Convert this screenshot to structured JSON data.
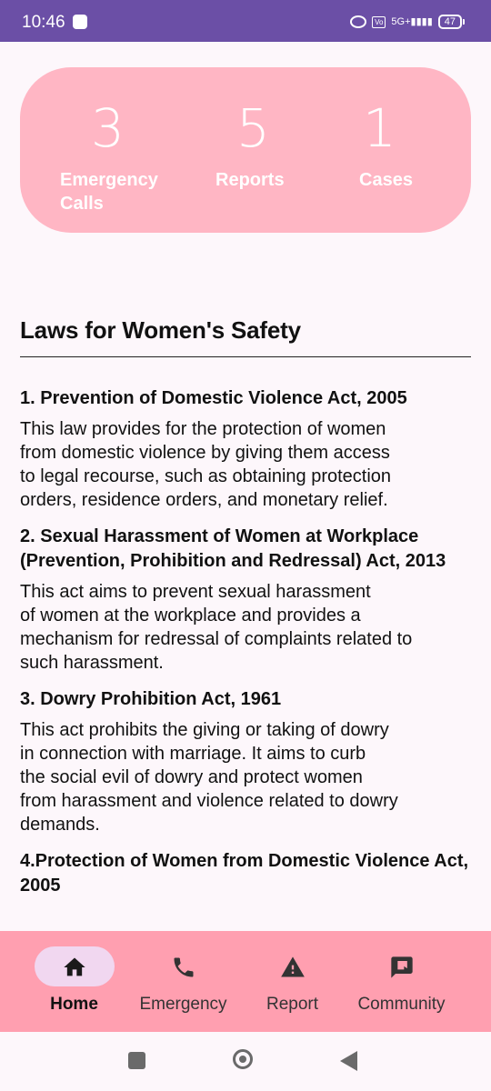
{
  "status_bar": {
    "time": "10:46",
    "network": "5G+",
    "volte": "Vo LTE",
    "battery": "47"
  },
  "stats": {
    "emergency_calls": {
      "count": "3",
      "label": "Emergency Calls"
    },
    "reports": {
      "count": "5",
      "label": "Reports"
    },
    "cases": {
      "count": "1",
      "label": "Cases"
    },
    "card_color": "#ffb6c4"
  },
  "section": {
    "title": "Laws for Women's Safety"
  },
  "laws": [
    {
      "title": "1. Prevention of Domestic Violence Act, 2005",
      "text": "This law provides for the protection of women\nfrom domestic violence by giving them access\nto legal recourse, such as obtaining protection\norders, residence orders, and monetary relief."
    },
    {
      "title": "2. Sexual Harassment of Women at Workplace (Prevention, Prohibition and Redressal) Act, 2013",
      "text": "This act aims to prevent sexual harassment\nof women at the workplace and provides a\nmechanism for redressal of complaints related to\nsuch harassment."
    },
    {
      "title": "3. Dowry Prohibition Act, 1961",
      "text": " This act prohibits the giving or taking of dowry\nin connection with marriage. It aims to curb\nthe social evil of dowry and protect women\nfrom harassment and violence related to dowry\ndemands."
    },
    {
      "title": "4.Protection of Women from Domestic Violence Act, 2005",
      "text": ""
    }
  ],
  "bottom_nav": {
    "items": [
      {
        "label": "Home",
        "icon": "home-icon",
        "active": true
      },
      {
        "label": "Emergency",
        "icon": "phone-icon",
        "active": false
      },
      {
        "label": "Report",
        "icon": "warning-icon",
        "active": false
      },
      {
        "label": "Community",
        "icon": "chat-icon",
        "active": false
      }
    ],
    "background": "#ff9fb0",
    "active_pill": "#f1d7f0"
  },
  "colors": {
    "status_bar": "#6b4fa6",
    "background": "#fdf7fb"
  }
}
